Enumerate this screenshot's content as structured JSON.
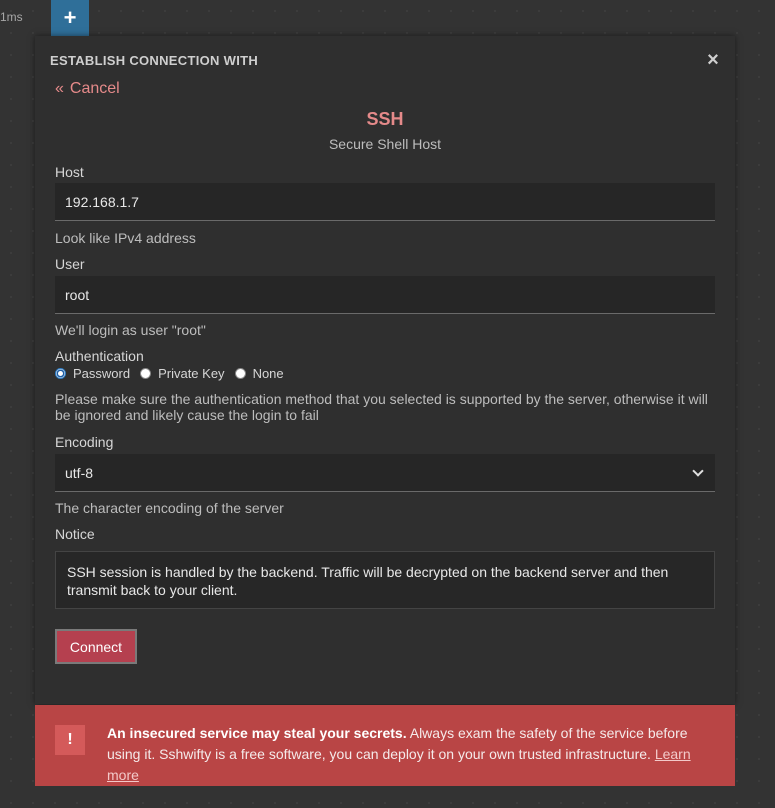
{
  "topbar": {
    "latency": "1ms",
    "add_tab_label": "+"
  },
  "dialog": {
    "title": "ESTABLISH CONNECTION WITH",
    "close_label": "×",
    "cancel_arrow": "«",
    "cancel_label": "Cancel",
    "protocol_name": "SSH",
    "protocol_desc": "Secure Shell Host",
    "host": {
      "label": "Host",
      "value": "192.168.1.7",
      "hint": "Look like IPv4 address"
    },
    "user": {
      "label": "User",
      "value": "root",
      "hint": "We'll login as user \"root\""
    },
    "authentication": {
      "label": "Authentication",
      "options": [
        "Password",
        "Private Key",
        "None"
      ],
      "selected": "Password",
      "hint": "Please make sure the authentication method that you selected is supported by the server, otherwise it will be ignored and likely cause the login to fail"
    },
    "encoding": {
      "label": "Encoding",
      "value": "utf-8",
      "hint": "The character encoding of the server"
    },
    "notice": {
      "label": "Notice",
      "text": "SSH session is handled by the backend. Traffic will be decrypted on the backend server and then transmit back to your client."
    },
    "connect_label": "Connect"
  },
  "warning": {
    "icon": "!",
    "strong": "An insecured service may steal your secrets.",
    "text": " Always exam the safety of the service before using it. Sshwifty is a free software, you can deploy it on your own trusted infrastructure. ",
    "link": "Learn more"
  },
  "colors": {
    "accent": "#e58a8a",
    "connect_button": "#b5404f",
    "warning_bar": "#b94545",
    "add_tab": "#2f6f99"
  }
}
